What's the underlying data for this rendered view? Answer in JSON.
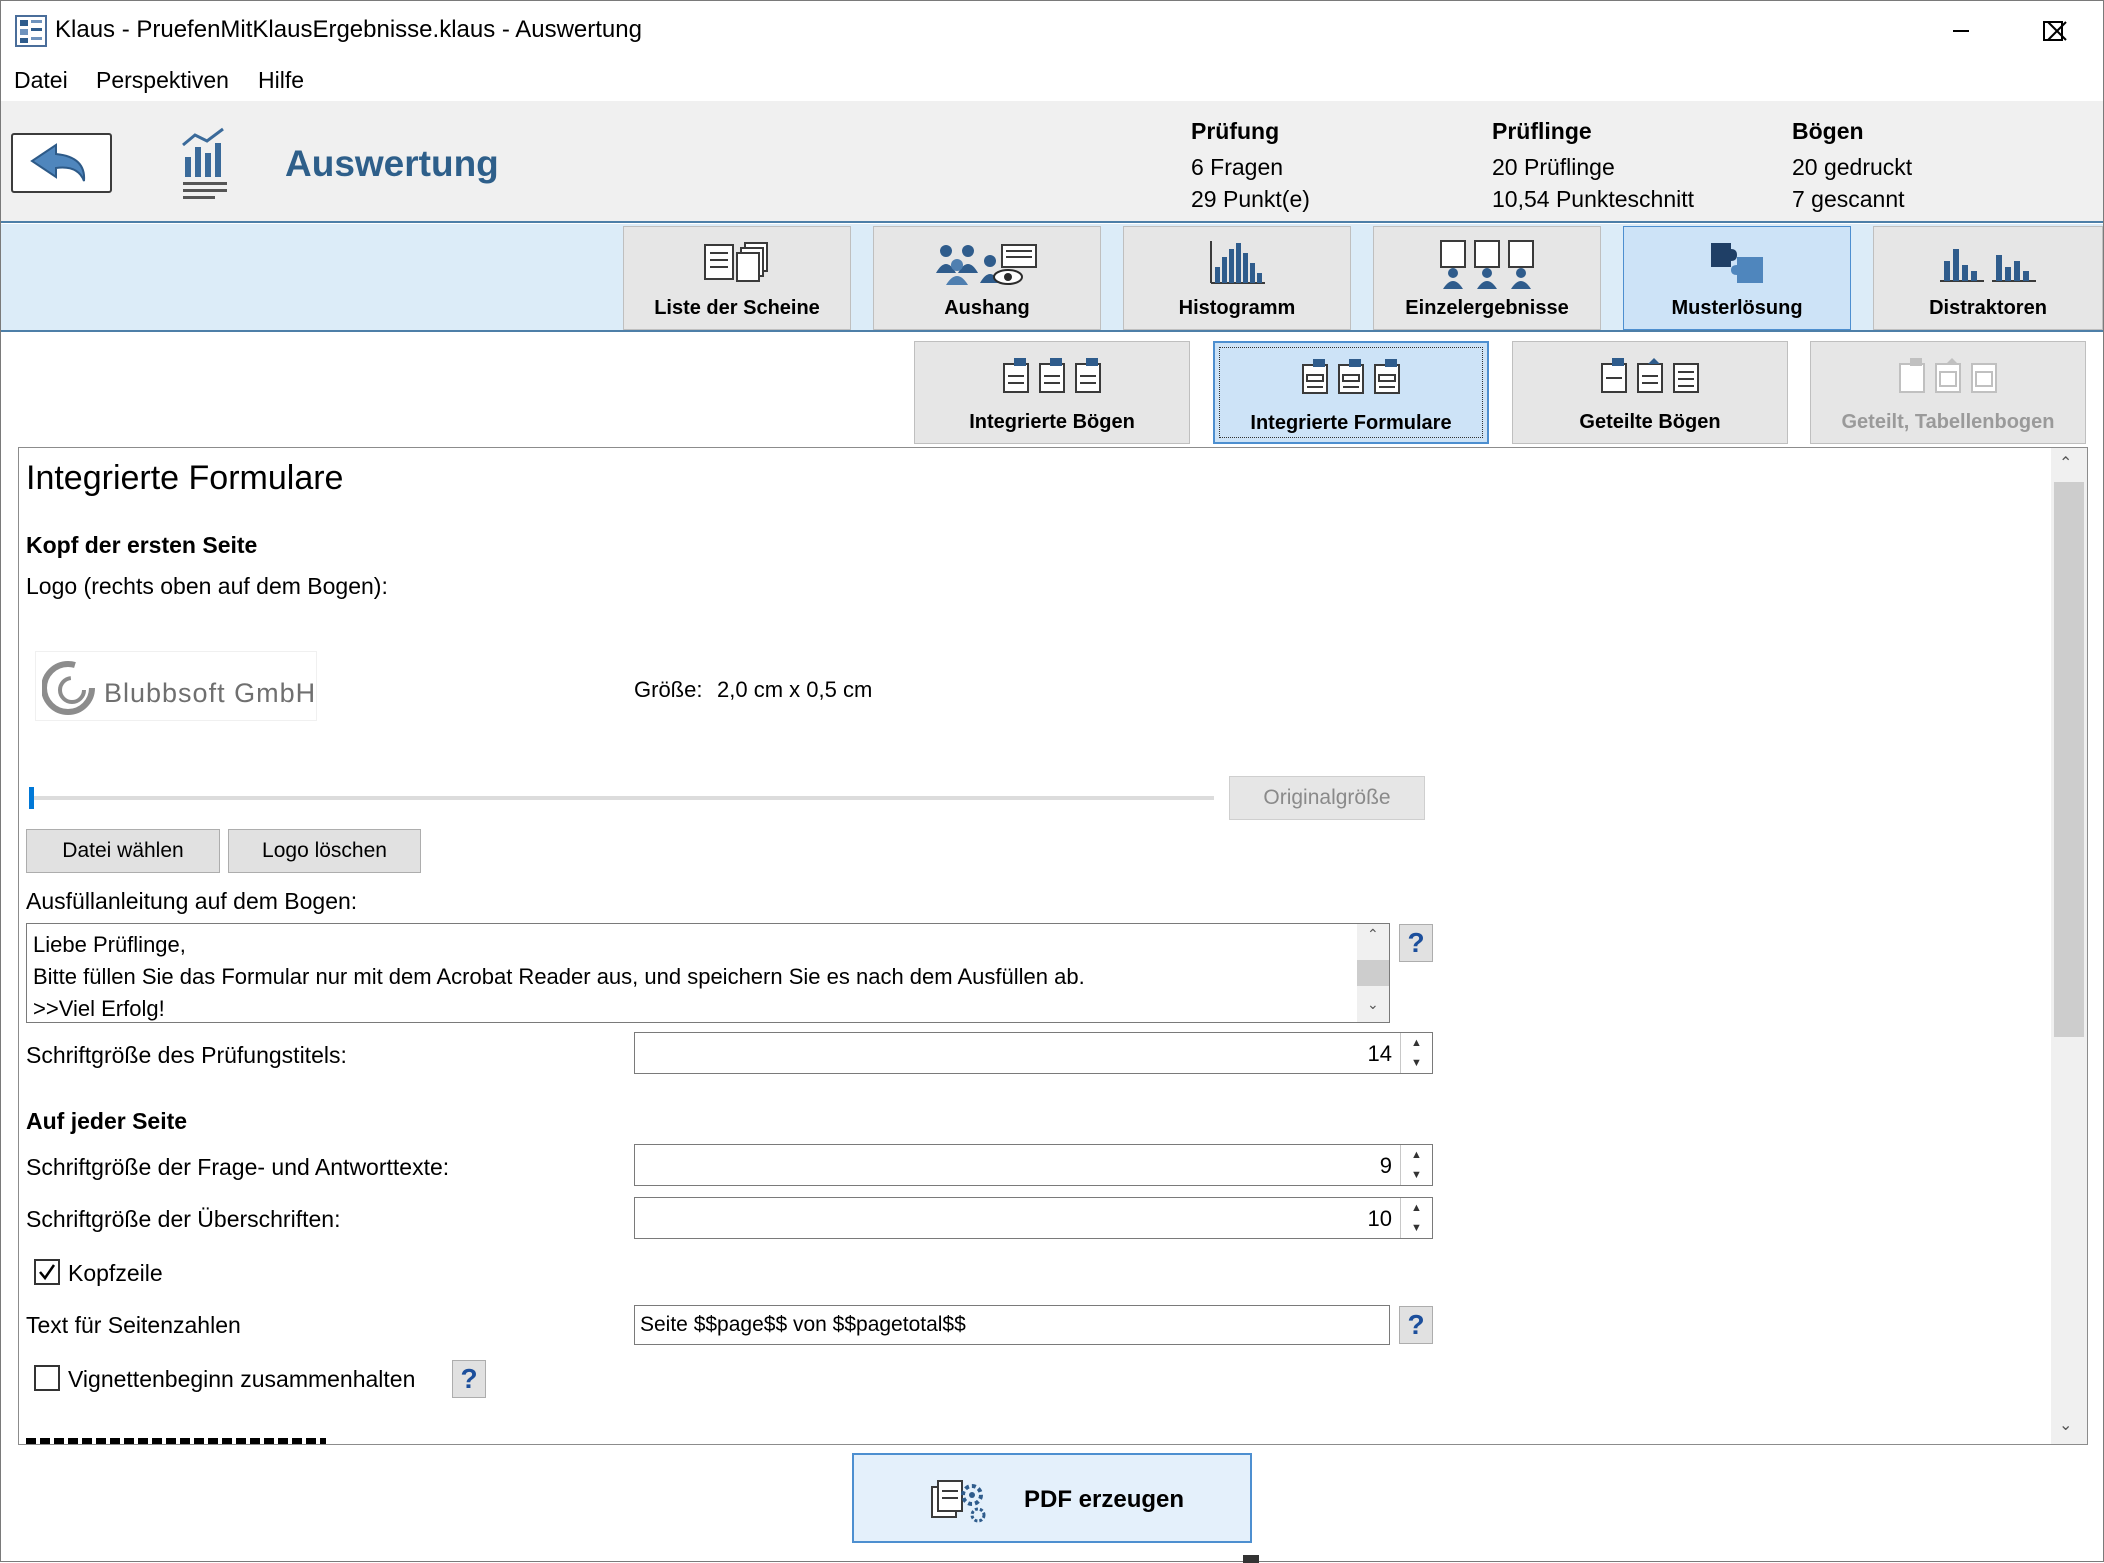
{
  "window": {
    "title": "Klaus - PruefenMitKlausErgebnisse.klaus - Auswertung"
  },
  "menu": {
    "items": [
      "Datei",
      "Perspektiven",
      "Hilfe"
    ]
  },
  "header": {
    "title": "Auswertung",
    "stats": [
      {
        "heading": "Prüfung",
        "line1": "6 Fragen",
        "line2": "29 Punkt(e)"
      },
      {
        "heading": "Prüflinge",
        "line1": "20 Prüflinge",
        "line2": "10,54 Punkteschnitt"
      },
      {
        "heading": "Bögen",
        "line1": "20 gedruckt",
        "line2": "7 gescannt"
      }
    ]
  },
  "tabs": [
    {
      "label": "Liste der Scheine",
      "icon": "list-sheets-icon"
    },
    {
      "label": "Aushang",
      "icon": "people-notice-icon"
    },
    {
      "label": "Histogramm",
      "icon": "histogram-icon"
    },
    {
      "label": "Einzelergebnisse",
      "icon": "individual-results-icon"
    },
    {
      "label": "Musterlösung",
      "icon": "puzzle-icon",
      "active": true
    },
    {
      "label": "Distraktoren",
      "icon": "distractor-chart-icon"
    }
  ],
  "subtabs": [
    {
      "label": "Integrierte Bögen"
    },
    {
      "label": "Integrierte Formulare",
      "active": true
    },
    {
      "label": "Geteilte Bögen"
    },
    {
      "label": "Geteilt, Tabellenbogen",
      "disabled": true
    }
  ],
  "form": {
    "heading": "Integrierte Formulare",
    "section_first_page": "Kopf der ersten Seite",
    "logo_label": "Logo (rechts oben auf dem Bogen):",
    "logo_text": "Blubbsoft GmbH",
    "size_label": "Größe:",
    "size_value": "2,0 cm x 0,5 cm",
    "original_size_button": "Originalgröße",
    "choose_file_button": "Datei wählen",
    "delete_logo_button": "Logo löschen",
    "instructions_label": "Ausfüllanleitung auf dem Bogen:",
    "instructions_lines": [
      "Liebe Prüflinge,",
      "Bitte füllen Sie das Formular nur mit dem Acrobat Reader aus, und speichern Sie es nach dem Ausfüllen ab.",
      ">>Viel Erfolg!"
    ],
    "title_font_label": "Schriftgröße des Prüfungstitels:",
    "title_font_value": "14",
    "section_every_page": "Auf jeder Seite",
    "qa_font_label": "Schriftgröße der Frage- und Antworttexte:",
    "qa_font_value": "9",
    "heading_font_label": "Schriftgröße der Überschriften:",
    "heading_font_value": "10",
    "header_checkbox_label": "Kopfzeile",
    "header_checkbox_checked": true,
    "page_number_label": "Text für Seitenzahlen",
    "page_number_value": "Seite $$page$$ von $$pagetotal$$",
    "vignette_checkbox_label": "Vignettenbeginn zusammenhalten",
    "vignette_checkbox_checked": false,
    "help_glyph": "?"
  },
  "footer": {
    "pdf_button": "PDF erzeugen"
  },
  "colors": {
    "accent": "#2e5f8a",
    "tabstrip": "#dcecf8",
    "active_tab": "#cde3f7"
  }
}
